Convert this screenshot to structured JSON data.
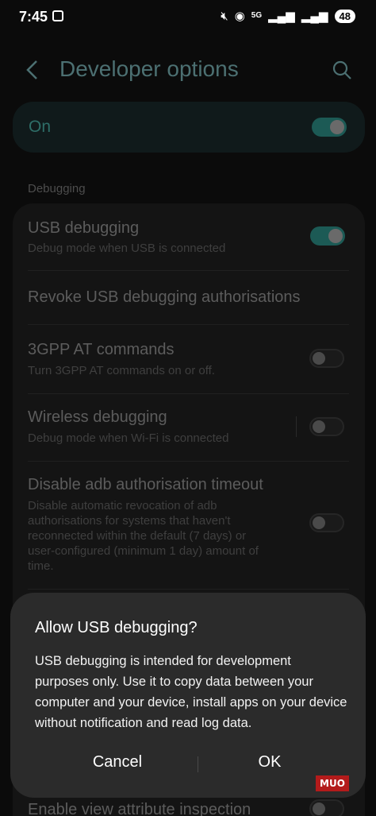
{
  "status_bar": {
    "time": "7:45",
    "network": "5G",
    "battery": "48"
  },
  "header": {
    "title": "Developer options"
  },
  "master_toggle": {
    "label": "On",
    "state": "on"
  },
  "section": {
    "label": "Debugging"
  },
  "settings": [
    {
      "title": "USB debugging",
      "subtitle": "Debug mode when USB is connected",
      "toggle": "on"
    },
    {
      "title": "Revoke USB debugging authorisations"
    },
    {
      "title": "3GPP AT commands",
      "subtitle": "Turn 3GPP AT commands on or off.",
      "toggle": "off"
    },
    {
      "title": "Wireless debugging",
      "subtitle": "Debug mode when Wi-Fi is connected",
      "toggle": "off"
    },
    {
      "title": "Disable adb authorisation timeout",
      "subtitle_lines": [
        "Disable automatic revocation of adb",
        "authorisations for systems that haven't",
        "reconnected within the default (7 days) or",
        "user-configured (minimum 1 day) amount of",
        "time."
      ],
      "toggle": "off"
    },
    {
      "title": "Enable view attribute inspection",
      "toggle": "off"
    }
  ],
  "dialog": {
    "title": "Allow USB debugging?",
    "body": "USB debugging is intended for development purposes only. Use it to copy data between your computer and your device, install apps on your device without notification and read log data.",
    "cancel_label": "Cancel",
    "ok_label": "OK"
  },
  "watermark": "MUO",
  "colors": {
    "accent": "#4c7072",
    "toggle_on": "#1c5a55",
    "dialog_bg": "#2b2b2b"
  }
}
